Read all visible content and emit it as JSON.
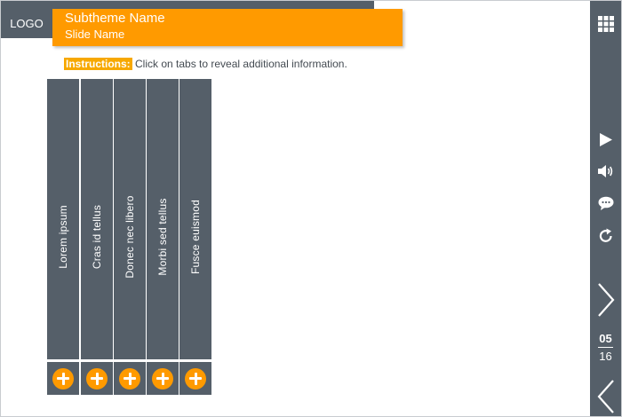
{
  "header": {
    "logo": "LOGO",
    "subtheme": "Subtheme Name",
    "slide_name": "Slide Name"
  },
  "instructions": {
    "label": "Instructions:",
    "text": " Click on tabs to reveal additional information."
  },
  "tabs": [
    {
      "label": "Lorem ipsum"
    },
    {
      "label": "Cras id tellus"
    },
    {
      "label": "Donec nec libero"
    },
    {
      "label": "Morbi sed tellus"
    },
    {
      "label": "Fusce euismod"
    }
  ],
  "sidebar": {
    "icons": [
      "grid-menu-icon",
      "play-icon",
      "volume-icon",
      "comment-icon",
      "replay-icon",
      "next-icon",
      "prev-icon"
    ],
    "page_current": "05",
    "page_total": "16"
  },
  "colors": {
    "accent": "#ff9a00",
    "panel": "#555f69",
    "text": "#444b52"
  }
}
